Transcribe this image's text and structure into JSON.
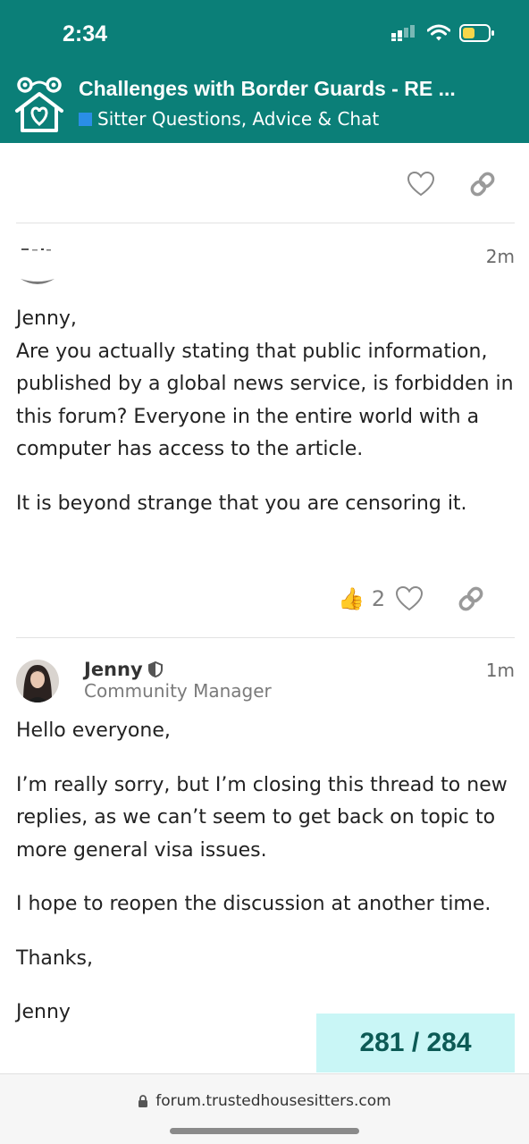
{
  "status": {
    "time": "2:34"
  },
  "header": {
    "title": "Challenges with Border Guards - RE ...",
    "category": "Sitter Questions, Advice & Chat",
    "category_color": "#2a8ee6",
    "bg_color": "#0b7f78"
  },
  "posts": [
    {
      "time": "2m",
      "paragraphs": [
        "Jenny,\nAre you actually stating that public information, published by a global news service, is forbidden in this forum? Everyone in the entire world with a computer has access to the article.",
        "It is beyond strange that you are censoring it."
      ],
      "reaction": {
        "icon": "thumbs-up-icon",
        "count": "2"
      }
    },
    {
      "author": "Jenny",
      "role": "Community Manager",
      "time": "1m",
      "paragraphs": [
        "Hello everyone,",
        "I’m really sorry, but I’m closing this thread to new replies, as we can’t seem to get back on topic to more general visa issues.",
        "I hope to reopen the discussion at another time.",
        "Thanks,",
        "Jenny"
      ]
    }
  ],
  "progress": "281 / 284",
  "url": "forum.trustedhousesitters.com"
}
